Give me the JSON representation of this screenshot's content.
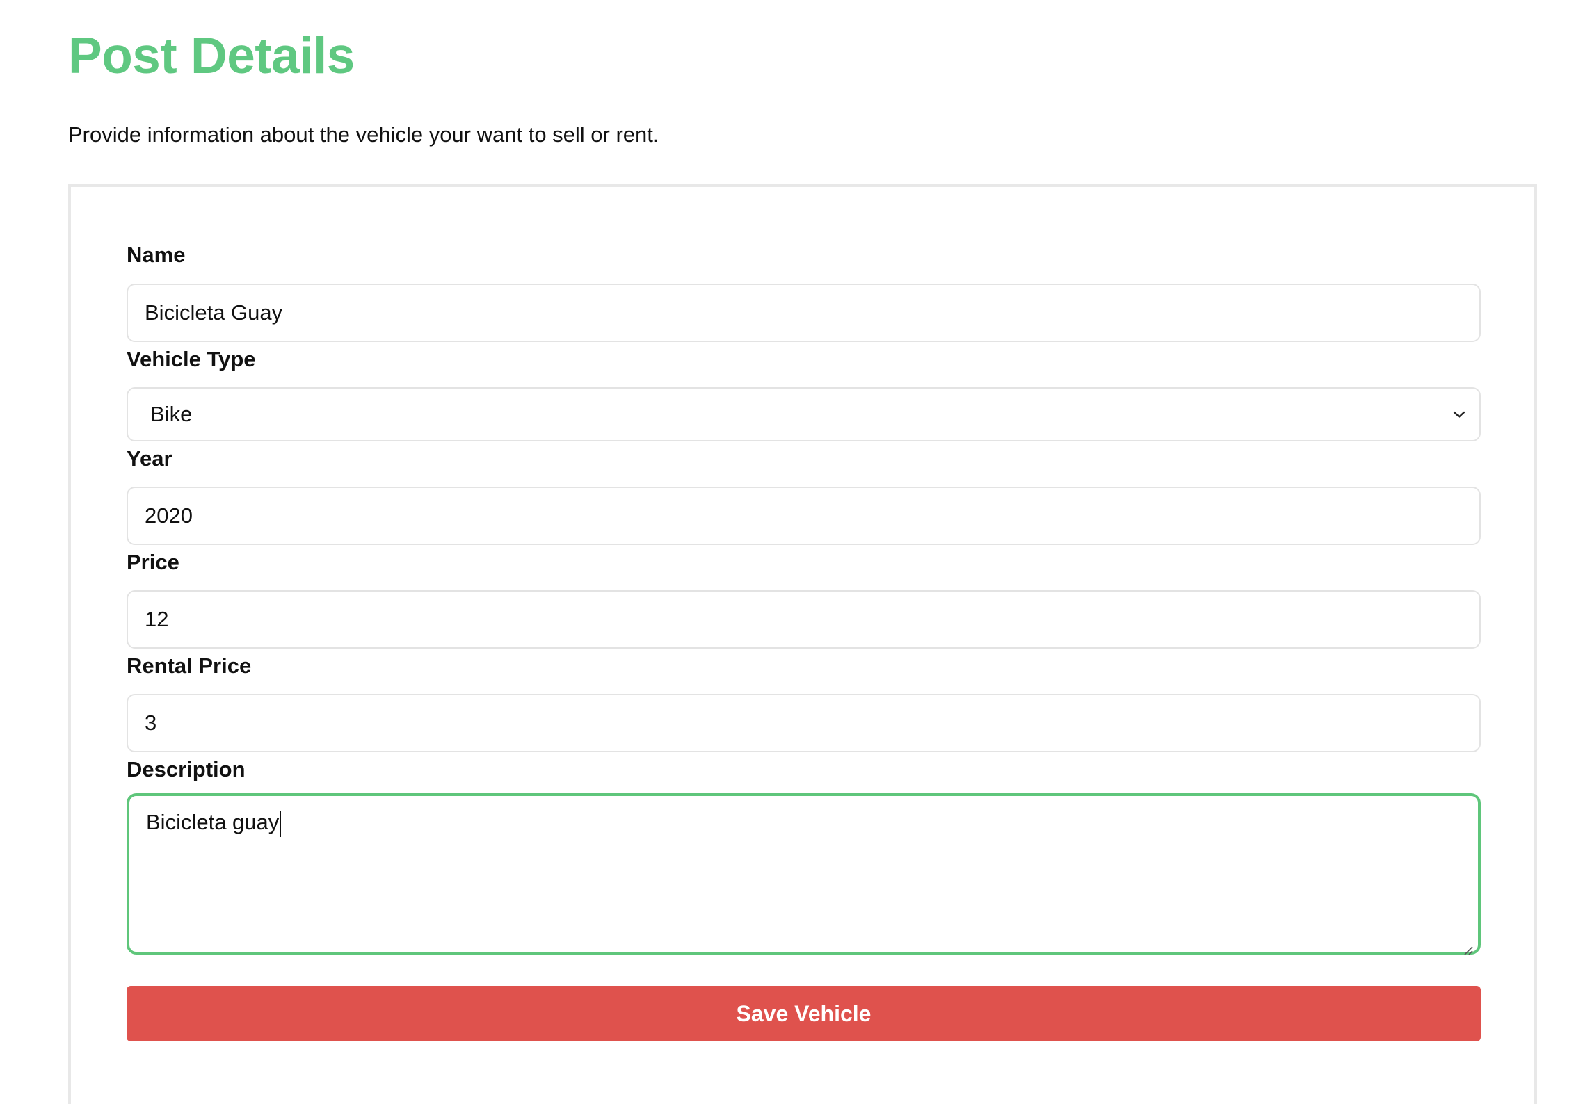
{
  "header": {
    "title": "Post Details",
    "subtitle": "Provide information about the vehicle your want to sell or rent."
  },
  "form": {
    "name": {
      "label": "Name",
      "value": "Bicicleta Guay"
    },
    "vehicle_type": {
      "label": "Vehicle Type",
      "value": "Bike",
      "icon": "chevron-down-icon"
    },
    "year": {
      "label": "Year",
      "value": "2020"
    },
    "price": {
      "label": "Price",
      "value": "12"
    },
    "rental_price": {
      "label": "Rental Price",
      "value": "3"
    },
    "description": {
      "label": "Description",
      "value": "Bicicleta guay",
      "focused": true
    },
    "save_label": "Save Vehicle"
  },
  "colors": {
    "title": "#5fc881",
    "focus_border": "#5fc67b",
    "save_button": "#df524d"
  }
}
